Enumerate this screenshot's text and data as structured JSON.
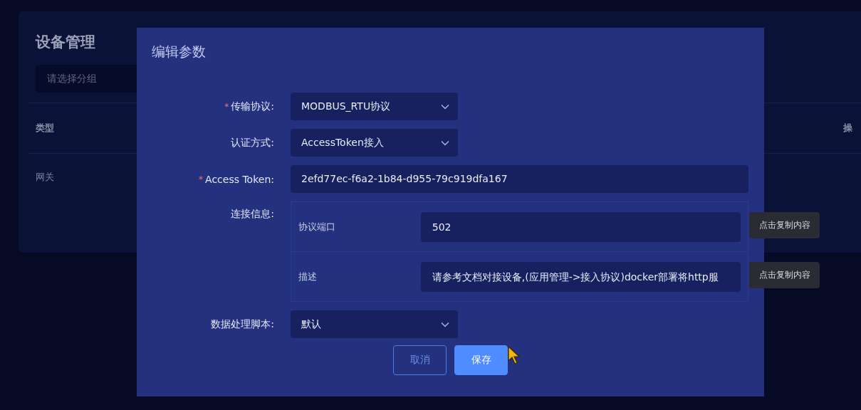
{
  "page": {
    "title": "设备管理",
    "group_select": {
      "placeholder": "请选择分组"
    },
    "table": {
      "columns": [
        "类型",
        "操"
      ],
      "rows": [
        [
          "网关"
        ]
      ]
    }
  },
  "dialog": {
    "title": "编辑参数",
    "fields": [
      {
        "kind": "select",
        "label": "传输协议:",
        "required_mark": "*",
        "value": "MODBUS_RTU协议"
      },
      {
        "kind": "select",
        "label": "认证方式:",
        "value": "AccessToken接入"
      },
      {
        "kind": "input",
        "label": "Access Token:",
        "required_mark": "*",
        "value": "2efd77ec-f6a2-1b84-d955-79c919dfa167"
      },
      {
        "kind": "group",
        "label": "连接信息:",
        "items": [
          {
            "label": "协议端口",
            "value": "502",
            "tooltip": "点击复制内容"
          },
          {
            "label": "描述",
            "value": "请参考文档对接设备,(应用管理->接入协议)docker部署将http服",
            "tooltip": "点击复制内容"
          }
        ]
      },
      {
        "kind": "select",
        "label": "数据处理脚本:",
        "value": "默认"
      }
    ],
    "buttons": [
      {
        "label": "取消",
        "kind": "secondary"
      },
      {
        "label": "保存",
        "kind": "primary"
      }
    ]
  }
}
